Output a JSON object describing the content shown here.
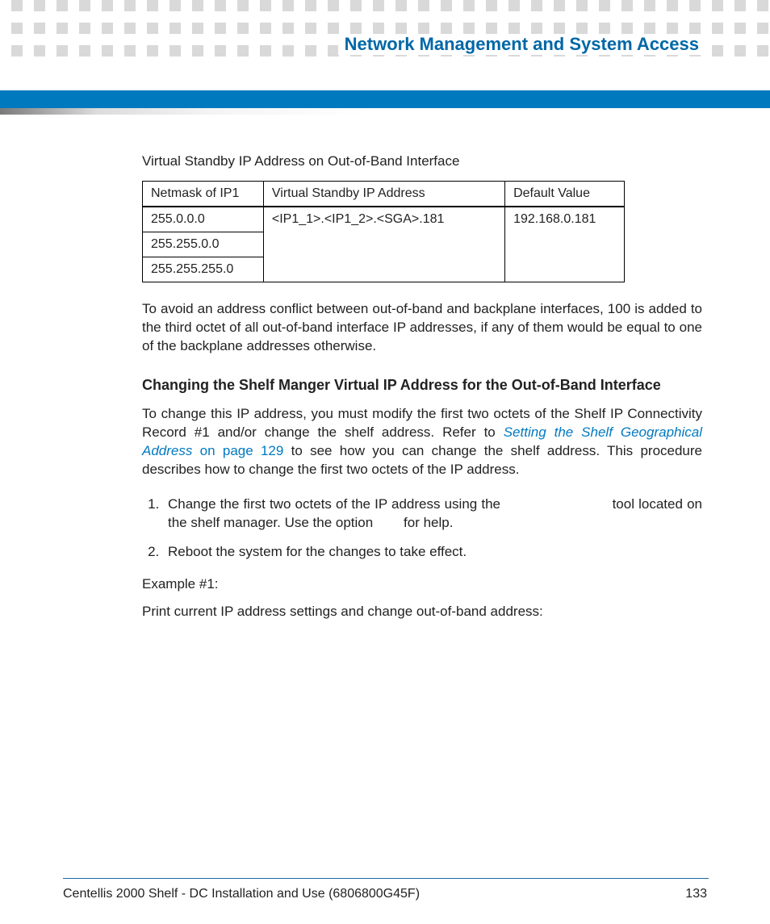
{
  "header": {
    "section_title": "Network Management and System Access"
  },
  "content": {
    "caption": "Virtual Standby IP Address on Out-of-Band Interface",
    "table": {
      "head": {
        "c1": "Netmask of IP1",
        "c2": "Virtual Standby IP Address",
        "c3": "Default Value"
      },
      "rows": {
        "r1": {
          "c1": "255.0.0.0"
        },
        "r2": {
          "c1": "255.255.0.0"
        },
        "r3": {
          "c1": "255.255.255.0"
        },
        "merged_c2": "<IP1_1>.<IP1_2>.<SGA>.181",
        "merged_c3": "192.168.0.181"
      }
    },
    "para1": "To avoid an address conflict between out-of-band and backplane interfaces, 100 is added to the third octet of all out-of-band interface IP addresses, if any of them would be equal to one of the backplane addresses otherwise.",
    "heading": "Changing the Shelf Manger Virtual IP Address for the Out-of-Band Interface",
    "para2_a": "To change this IP address, you must modify the first two octets of the Shelf IP Connectivity Record #1 and/or change the shelf address. Refer to ",
    "para2_link_italic": "Setting the Shelf Geographical Address",
    "para2_link_plain": " on page 129",
    "para2_b": " to see how you can change the shelf address. This procedure describes how to change the first two octets of the IP address.",
    "step1_a": "Change the first two octets of the IP address using the ",
    "step1_gap": "                         ",
    "step1_b": " tool located on the shelf manager. Use the option ",
    "step1_gap2": "      ",
    "step1_c": " for help.",
    "step2": "Reboot the system for the changes to take effect.",
    "example_label": "Example #1:",
    "example_text": "Print current IP address settings and change out-of-band address:"
  },
  "footer": {
    "left": "Centellis 2000 Shelf - DC Installation and Use (6806800G45F)",
    "right": "133"
  }
}
